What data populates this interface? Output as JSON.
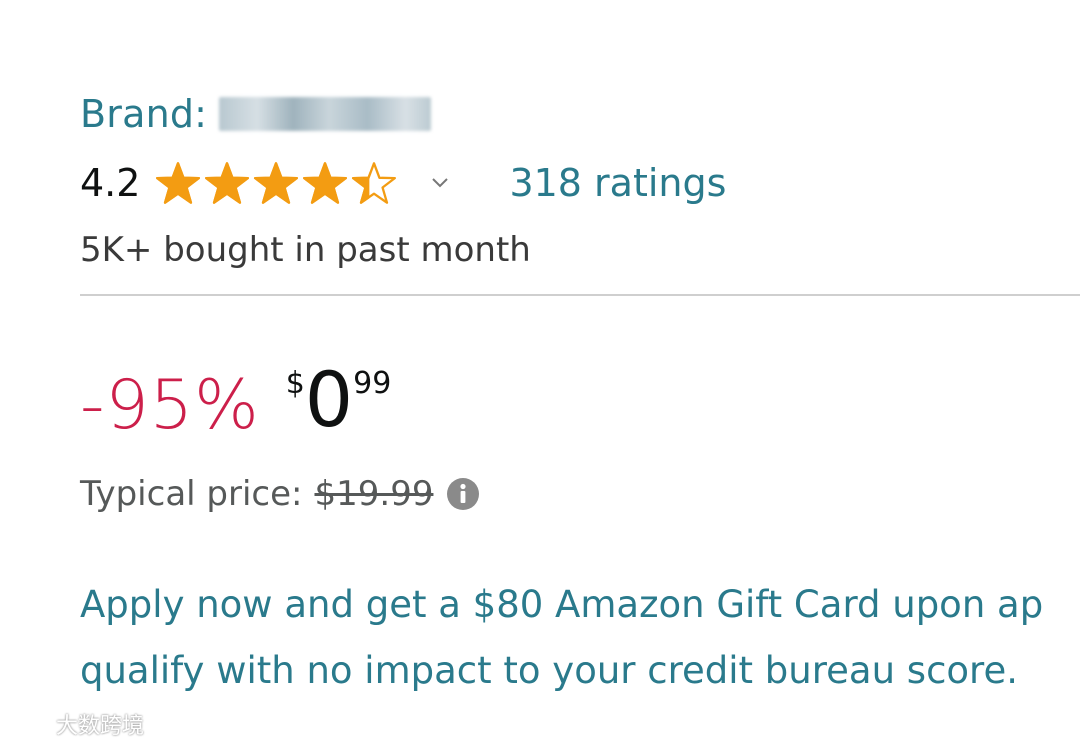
{
  "brand": {
    "label": "Brand:"
  },
  "rating": {
    "value": "4.2",
    "stars": 4.2,
    "max_stars": 5,
    "count_label": "318 ratings"
  },
  "bought": "5K+ bought in past month",
  "price": {
    "discount": "-95%",
    "currency_symbol": "$",
    "whole": "0",
    "fraction": "99"
  },
  "typical_price": {
    "label": "Typical price:",
    "value": "$19.99"
  },
  "promo": {
    "line1": "Apply now and get a $80 Amazon Gift Card upon ap",
    "line2": "qualify with no impact to your credit bureau score."
  },
  "watermark": "大数跨境",
  "colors": {
    "link": "#2a7a8c",
    "star": "#f39c12",
    "discount": "#cc1f4a",
    "muted": "#565959"
  },
  "icons": [
    "star-icon",
    "chevron-down-icon",
    "info-icon",
    "watermark-logo-icon"
  ]
}
